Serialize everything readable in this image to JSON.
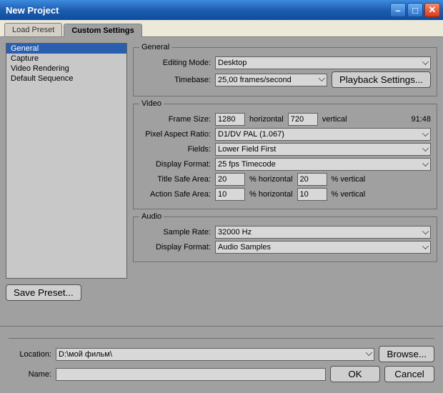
{
  "title": "New Project",
  "tabs": {
    "load": "Load Preset",
    "custom": "Custom Settings"
  },
  "sidebar": {
    "items": [
      "General",
      "Capture",
      "Video Rendering",
      "Default Sequence"
    ]
  },
  "general": {
    "legend": "General",
    "editing_mode_lbl": "Editing Mode:",
    "editing_mode": "Desktop",
    "timebase_lbl": "Timebase:",
    "timebase": "25,00 frames/second",
    "playback_settings": "Playback Settings..."
  },
  "video": {
    "legend": "Video",
    "frame_size_lbl": "Frame Size:",
    "frame_w": "1280",
    "horiz": "horizontal",
    "frame_h": "720",
    "vert": "vertical",
    "ratio_display": "91:48",
    "par_lbl": "Pixel Aspect Ratio:",
    "par": "D1/DV PAL (1.067)",
    "fields_lbl": "Fields:",
    "fields": "Lower Field First",
    "dformat_lbl": "Display Format:",
    "dformat": "25 fps Timecode",
    "tsafe_lbl": "Title Safe Area:",
    "tsafe_h": "20",
    "tsafe_v": "20",
    "asafe_lbl": "Action Safe Area:",
    "asafe_h": "10",
    "asafe_v": "10",
    "pct_h": "% horizontal",
    "pct_v": "% vertical"
  },
  "audio": {
    "legend": "Audio",
    "rate_lbl": "Sample Rate:",
    "rate": "32000 Hz",
    "dformat_lbl": "Display Format:",
    "dformat": "Audio Samples"
  },
  "save_preset": "Save Preset...",
  "bottom": {
    "location_lbl": "Location:",
    "location": "D:\\мой фильм\\",
    "browse": "Browse...",
    "name_lbl": "Name:",
    "name": "",
    "ok": "OK",
    "cancel": "Cancel"
  }
}
